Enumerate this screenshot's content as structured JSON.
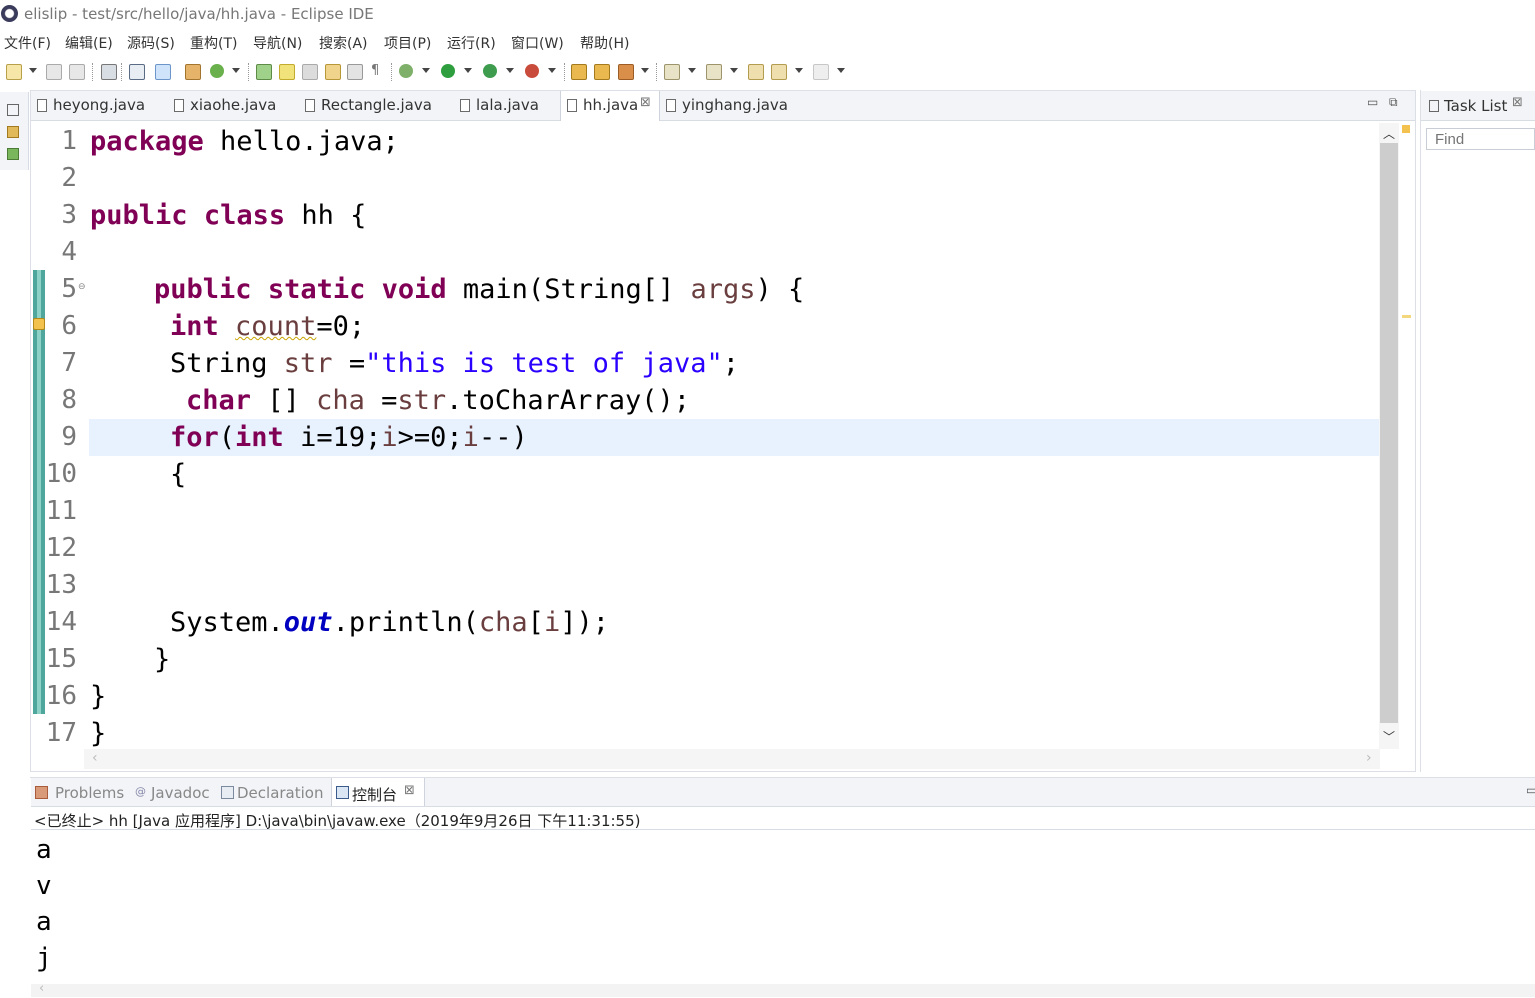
{
  "window": {
    "title": "elislip - test/src/hello/java/hh.java - Eclipse IDE"
  },
  "menu": [
    "文件(F)",
    "编辑(E)",
    "源码(S)",
    "重构(T)",
    "导航(N)",
    "搜索(A)",
    "项目(P)",
    "运行(R)",
    "窗口(W)",
    "帮助(H)"
  ],
  "editor": {
    "tabs": [
      {
        "label": "heyong.java"
      },
      {
        "label": "xiaohe.java"
      },
      {
        "label": "Rectangle.java"
      },
      {
        "label": "lala.java"
      },
      {
        "label": "hh.java",
        "active": true
      },
      {
        "label": "yinghang.java"
      }
    ],
    "close_glyph": "⊠",
    "line_numbers": [
      "1",
      "2",
      "3",
      "4",
      "5",
      "6",
      "7",
      "8",
      "9",
      "10",
      "11",
      "12",
      "13",
      "14",
      "15",
      "16",
      "17"
    ],
    "code": {
      "l1": {
        "kw": "package",
        "rest": " hello.java;"
      },
      "l3": {
        "kw1": "public",
        "kw2": "class",
        "rest": " hh {"
      },
      "l5": {
        "kw1": "public",
        "kw2": "static",
        "kw3": "void",
        "rest": " main(String[] ",
        "var": "args",
        "end": ") {"
      },
      "l6": {
        "kw": "int",
        "var": "count",
        "rest": "=0;"
      },
      "l7": {
        "type": "String ",
        "var": "str",
        "mid": " =",
        "str": "\"this is test of java\"",
        "end": ";"
      },
      "l8": {
        "kw": "char",
        "mid": " [] ",
        "var": "cha",
        "rest": " =",
        "var2": "str",
        "end": ".toCharArray();"
      },
      "l9": {
        "kw1": "for",
        "paren": "(",
        "kw2": "int",
        "rest": " i=19;",
        "v1": "i",
        "mid": ">=0;",
        "v2": "i",
        "end": "--)"
      },
      "l10": {
        "text": "{"
      },
      "l14": {
        "a": "System.",
        "fld": "out",
        "b": ".println(",
        "var": "cha",
        "c": "[",
        "var2": "i",
        "d": "]);"
      },
      "l15": {
        "text": "}"
      },
      "l16": {
        "text": "}"
      },
      "l17": {
        "text": "}"
      }
    }
  },
  "task_list": {
    "title": "Task List",
    "find_placeholder": "Find"
  },
  "bottom_panel": {
    "tabs": [
      {
        "label": "Problems"
      },
      {
        "label": "Javadoc"
      },
      {
        "label": "Declaration"
      },
      {
        "label": "控制台",
        "active": true
      }
    ],
    "console_status": "<已终止> hh [Java 应用程序] D:\\java\\bin\\javaw.exe（2019年9月26日 下午11:31:55)",
    "output": [
      "a",
      "v",
      "a",
      "j"
    ]
  },
  "colors": {
    "keyword": "#7f0055",
    "string": "#2a00ff",
    "field": "#0000c0",
    "change_bar": "#4fa69c",
    "current_line": "#e8f2fe"
  }
}
